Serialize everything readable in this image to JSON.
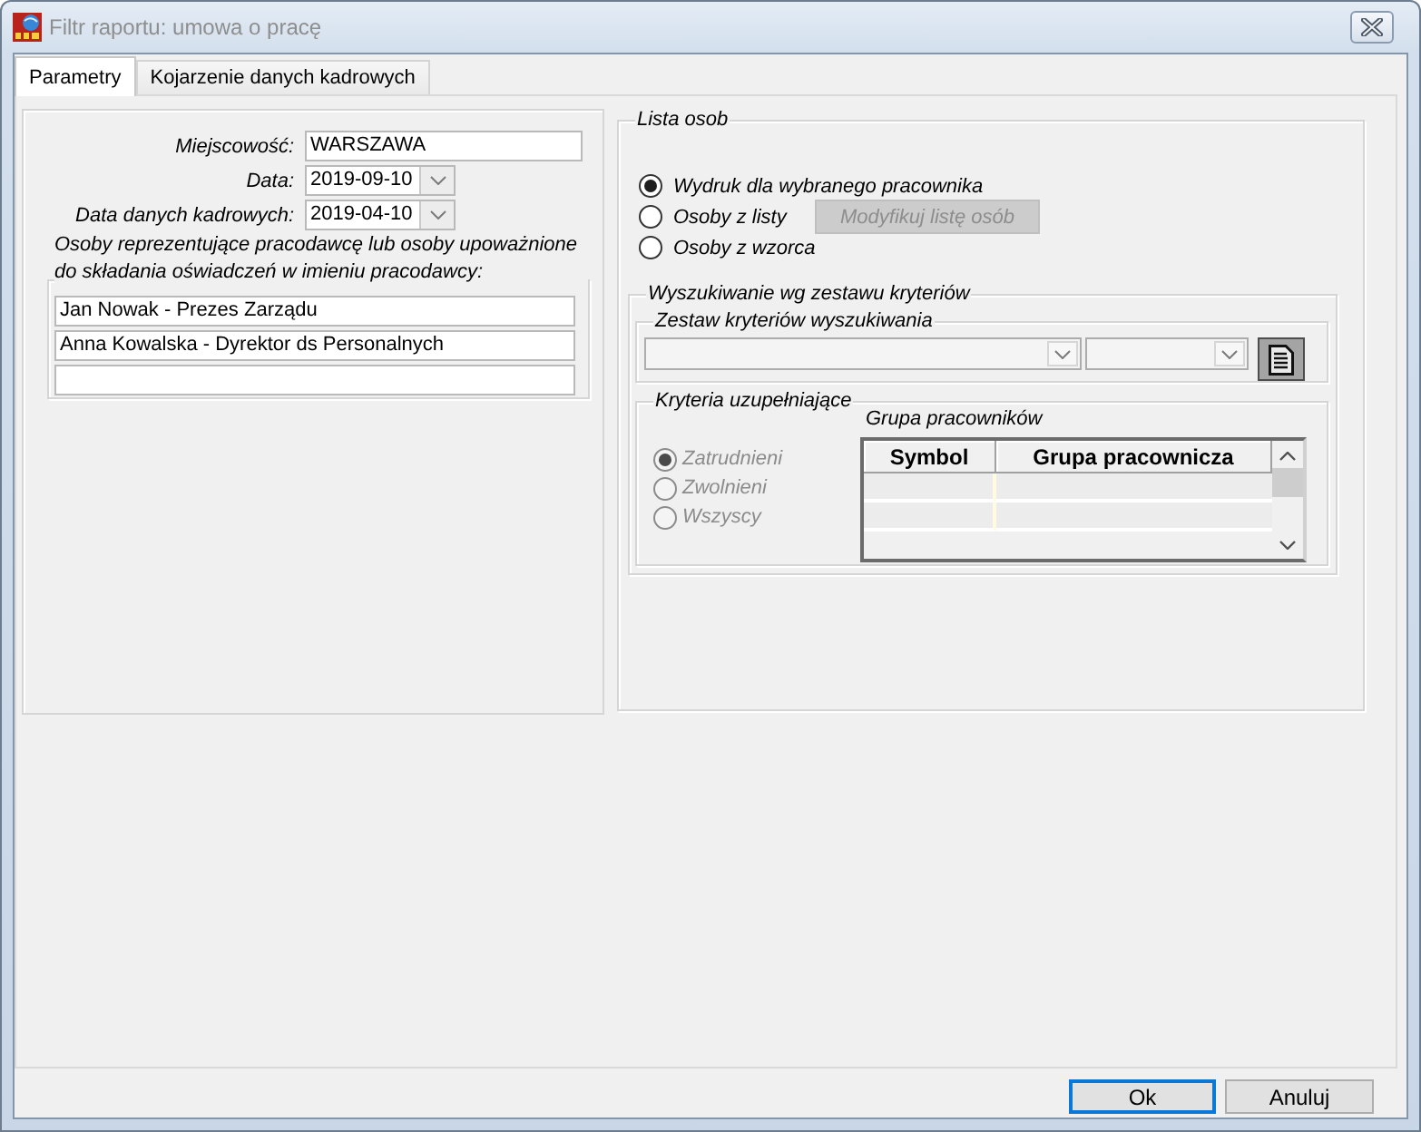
{
  "window": {
    "title": "Filtr raportu: umowa o pracę",
    "active": false
  },
  "tabs": [
    {
      "label": "Parametry",
      "selected": true
    },
    {
      "label": "Kojarzenie danych kadrowych",
      "selected": false
    }
  ],
  "fields": [
    {
      "kind": "text",
      "label": "Miejscowość:",
      "value": "WARSZAWA"
    },
    {
      "kind": "date",
      "label": "Data:",
      "value": "2019-09-10"
    },
    {
      "kind": "date",
      "label": "Data danych kadrowych:",
      "value": "2019-04-10"
    }
  ],
  "representatives": {
    "legend": "Osoby reprezentujące pracodawcę lub osoby upoważnione do składania oświadczeń w imieniu pracodawcy:",
    "fields": [
      {
        "kind": "filled",
        "value": "Jan Nowak - Prezes Zarządu"
      },
      {
        "kind": "filled",
        "value": "Anna Kowalska - Dyrektor ds Personalnych"
      },
      {
        "kind": "empty"
      }
    ]
  },
  "person_list": {
    "legend": "Lista osob",
    "options": [
      {
        "label": "Wydruk dla wybranego pracownika",
        "selected": true
      },
      {
        "label": "Osoby z listy",
        "selected": false
      },
      {
        "label": "Osoby z wzorca",
        "selected": false
      }
    ],
    "modify_button": {
      "label": "Modyfikuj listę osób",
      "disabled": true
    }
  },
  "criteria_search": {
    "legend": "Wyszukiwanie wg zestawu kryteriów",
    "criteria_set": {
      "legend": "Zestaw kryteriów wyszukiwania"
    },
    "supplementary": {
      "legend": "Kryteria uzupełniające",
      "options": [
        {
          "label": "Zatrudnieni",
          "selected": true,
          "disabled": true
        },
        {
          "label": "Zwolnieni",
          "selected": false,
          "disabled": true
        },
        {
          "label": "Wszyscy",
          "selected": false,
          "disabled": true
        }
      ],
      "employee_group": {
        "label": "Grupa pracowników",
        "columns": [
          "Symbol",
          "Grupa pracownicza"
        ],
        "rows": [
          {
            "kind": "blank"
          },
          {
            "kind": "blank"
          }
        ]
      }
    }
  },
  "buttons": [
    {
      "label": "Ok",
      "default": true
    },
    {
      "label": "Anuluj",
      "default": false
    }
  ]
}
